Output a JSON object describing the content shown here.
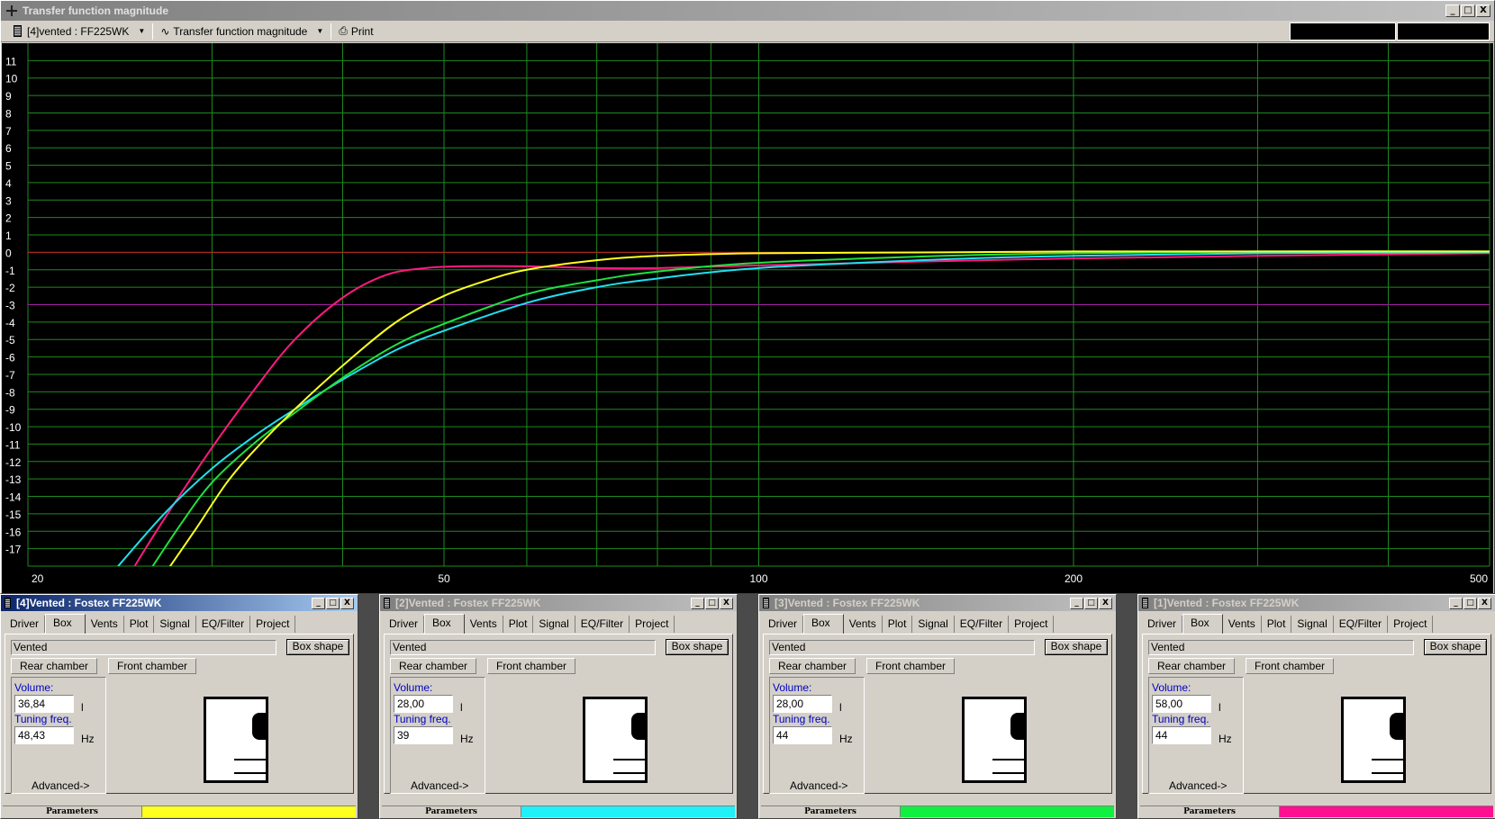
{
  "window": {
    "title": "Transfer function magnitude",
    "controls": [
      "_",
      "□",
      "X"
    ]
  },
  "toolbar": {
    "project_selector": "[4]vented : FF225WK",
    "plot_selector": "Transfer function magnitude",
    "print_label": "Print"
  },
  "chart_data": {
    "type": "line",
    "title": "Transfer function magnitude",
    "xlabel": "",
    "ylabel": "",
    "xscale": "log",
    "xlim": [
      20,
      500
    ],
    "ylim": [
      -18,
      12
    ],
    "x_tick_labels": [
      "20",
      "50",
      "100",
      "200",
      "500"
    ],
    "x_tick_values": [
      20,
      50,
      100,
      200,
      500
    ],
    "x_grid_values": [
      30,
      40,
      50,
      60,
      70,
      80,
      90,
      100,
      200,
      300,
      400
    ],
    "y_tick_labels": [
      "11",
      "10",
      "9",
      "8",
      "7",
      "6",
      "5",
      "4",
      "3",
      "2",
      "1",
      "0",
      "-1",
      "-2",
      "-3",
      "-4",
      "-5",
      "-6",
      "-7",
      "-8",
      "-9",
      "-10",
      "-11",
      "-12",
      "-13",
      "-14",
      "-15",
      "-16",
      "-17"
    ],
    "y_tick_values": [
      11,
      10,
      9,
      8,
      7,
      6,
      5,
      4,
      3,
      2,
      1,
      0,
      -1,
      -2,
      -3,
      -4,
      -5,
      -6,
      -7,
      -8,
      -9,
      -10,
      -11,
      -12,
      -13,
      -14,
      -15,
      -16,
      -17
    ],
    "reference_lines": [
      {
        "name": "0 dB",
        "y": 0,
        "color": "#c02020"
      },
      {
        "name": "-3 dB",
        "y": -3,
        "color": "#a020a0"
      }
    ],
    "grid": true,
    "background": "#000000",
    "grid_color": "#1f8a1f",
    "series": [
      {
        "name": "[1] Vented 58 l / 44 Hz",
        "color": "#ff1a80",
        "x": [
          25,
          27,
          30,
          33,
          36,
          40,
          44,
          48,
          52,
          60,
          70,
          80,
          100,
          150,
          200,
          300,
          500
        ],
        "y": [
          -18.5,
          -15.3,
          -11.2,
          -7.8,
          -5.0,
          -2.6,
          -1.3,
          -0.9,
          -0.8,
          -0.8,
          -0.9,
          -0.9,
          -0.75,
          -0.5,
          -0.35,
          -0.2,
          -0.05
        ]
      },
      {
        "name": "[2] Vented 28 l / 39 Hz",
        "color": "#20e0f0",
        "x": [
          24,
          27,
          30,
          33,
          36,
          40,
          45,
          50,
          60,
          70,
          80,
          100,
          150,
          200,
          300,
          500
        ],
        "y": [
          -18.5,
          -15.0,
          -12.4,
          -10.5,
          -9.0,
          -7.3,
          -5.6,
          -4.5,
          -2.9,
          -2.0,
          -1.5,
          -0.9,
          -0.4,
          -0.2,
          -0.05,
          0.0
        ]
      },
      {
        "name": "[3] Vented 28 l / 44 Hz",
        "color": "#20e040",
        "x": [
          26,
          28,
          30,
          33,
          36,
          40,
          45,
          50,
          60,
          70,
          80,
          100,
          150,
          200,
          300,
          500
        ],
        "y": [
          -18.5,
          -15.6,
          -13.2,
          -10.9,
          -9.2,
          -7.2,
          -5.3,
          -4.1,
          -2.4,
          -1.6,
          -1.1,
          -0.6,
          -0.2,
          -0.05,
          0.05,
          0.05
        ]
      },
      {
        "name": "[4] Vented 36,84 l / 48,43 Hz",
        "color": "#ffff20",
        "x": [
          27,
          29,
          31,
          33,
          36,
          40,
          45,
          50,
          55,
          60,
          70,
          80,
          100,
          150,
          200,
          300,
          500
        ],
        "y": [
          -18.5,
          -15.8,
          -13.2,
          -11.3,
          -9.0,
          -6.5,
          -4.0,
          -2.5,
          -1.6,
          -1.0,
          -0.45,
          -0.2,
          -0.05,
          0.0,
          0.05,
          0.05,
          0.05
        ]
      }
    ]
  },
  "panels": [
    {
      "title": "[4]Vented : Fostex FF225WK",
      "active": true,
      "tabs": [
        "Driver",
        "Box",
        "Vents",
        "Plot",
        "Signal",
        "EQ/Filter",
        "Project"
      ],
      "active_tab": "Box",
      "box_type": "Vented",
      "box_shape_label": "Box shape",
      "rear_chamber_label": "Rear chamber",
      "front_chamber_label": "Front chamber",
      "volume_label": "Volume:",
      "volume_value": "36,84",
      "volume_unit": "l",
      "tuning_label": "Tuning freq.",
      "tuning_value": "48,43",
      "tuning_unit": "Hz",
      "advanced_label": "Advanced->",
      "status_label": "Parameters",
      "series_color": "#ffff20"
    },
    {
      "title": "[2]Vented : Fostex FF225WK",
      "active": false,
      "tabs": [
        "Driver",
        "Box",
        "Vents",
        "Plot",
        "Signal",
        "EQ/Filter",
        "Project"
      ],
      "active_tab": "Box",
      "box_type": "Vented",
      "box_shape_label": "Box shape",
      "rear_chamber_label": "Rear chamber",
      "front_chamber_label": "Front chamber",
      "volume_label": "Volume:",
      "volume_value": "28,00",
      "volume_unit": "l",
      "tuning_label": "Tuning freq.",
      "tuning_value": "39",
      "tuning_unit": "Hz",
      "advanced_label": "Advanced->",
      "status_label": "Parameters",
      "series_color": "#20f0f8"
    },
    {
      "title": "[3]Vented : Fostex FF225WK",
      "active": false,
      "tabs": [
        "Driver",
        "Box",
        "Vents",
        "Plot",
        "Signal",
        "EQ/Filter",
        "Project"
      ],
      "active_tab": "Box",
      "box_type": "Vented",
      "box_shape_label": "Box shape",
      "rear_chamber_label": "Rear chamber",
      "front_chamber_label": "Front chamber",
      "volume_label": "Volume:",
      "volume_value": "28,00",
      "volume_unit": "l",
      "tuning_label": "Tuning freq.",
      "tuning_value": "44",
      "tuning_unit": "Hz",
      "advanced_label": "Advanced->",
      "status_label": "Parameters",
      "series_color": "#10f040"
    },
    {
      "title": "[1]Vented : Fostex FF225WK",
      "active": false,
      "tabs": [
        "Driver",
        "Box",
        "Vents",
        "Plot",
        "Signal",
        "EQ/Filter",
        "Project"
      ],
      "active_tab": "Box",
      "box_type": "Vented",
      "box_shape_label": "Box shape",
      "rear_chamber_label": "Rear chamber",
      "front_chamber_label": "Front chamber",
      "volume_label": "Volume:",
      "volume_value": "58,00",
      "volume_unit": "l",
      "tuning_label": "Tuning freq.",
      "tuning_value": "44",
      "tuning_unit": "Hz",
      "advanced_label": "Advanced->",
      "status_label": "Parameters",
      "series_color": "#ff1090"
    }
  ]
}
